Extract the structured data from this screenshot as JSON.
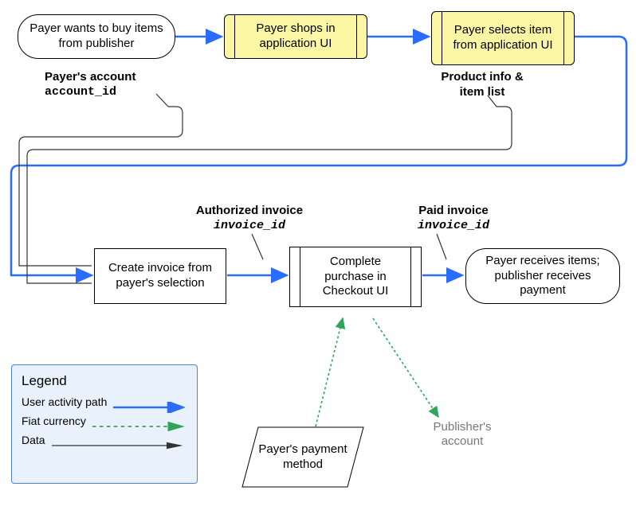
{
  "nodes": {
    "start": "Payer wants to buy items from publisher",
    "shop": "Payer shops in application UI",
    "select": "Payer selects item from application UI",
    "invoice": "Create invoice from payer's selection",
    "checkout": "Complete purchase in Checkout UI",
    "end": "Payer receives items; publisher receives payment",
    "payment_method": "Payer's payment method",
    "publisher_account": "Publisher's account"
  },
  "annotations": {
    "account_label": "Payer's account",
    "account_code": "account_id",
    "product_label": "Product info &",
    "product_label2": "item list",
    "auth_label": "Authorized invoice",
    "auth_code": "invoice_id",
    "paid_label": "Paid invoice",
    "paid_code": "invoice_id"
  },
  "legend": {
    "title": "Legend",
    "user_path": "User activity path",
    "fiat": "Fiat currency",
    "data": "Data"
  },
  "colors": {
    "activity": "#2a6cff",
    "fiat": "#2fa55a",
    "data": "#333333",
    "yellow_fill": "#fbf6a4"
  }
}
